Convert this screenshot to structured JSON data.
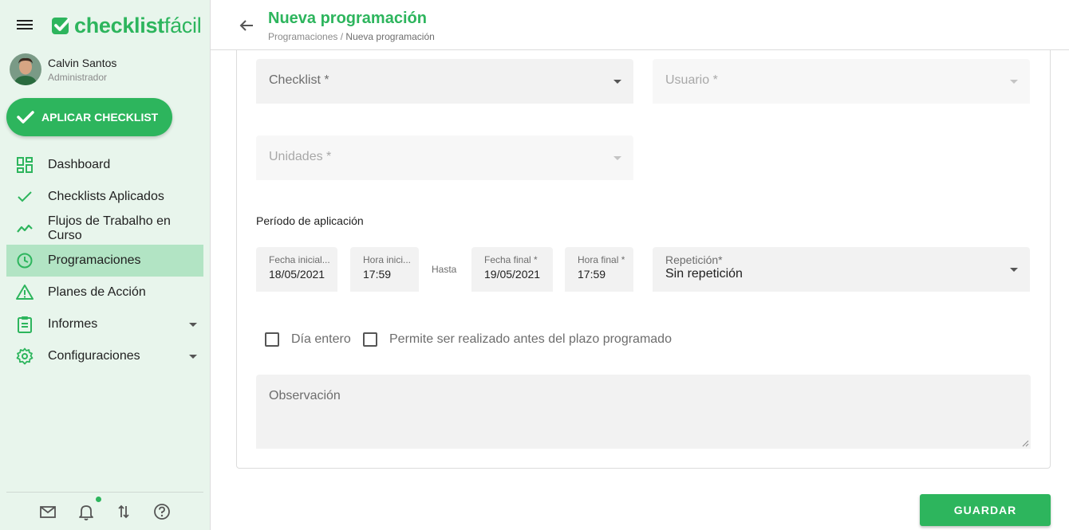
{
  "brand": {
    "name_bold": "checklist",
    "name_light": "fácil",
    "color": "#2db55d"
  },
  "user": {
    "name": "Calvin Santos",
    "role": "Administrador"
  },
  "apply_button": {
    "label": "APLICAR CHECKLIST"
  },
  "nav": {
    "items": [
      {
        "label": "Dashboard",
        "icon": "dashboard-icon"
      },
      {
        "label": "Checklists Aplicados",
        "icon": "check-icon"
      },
      {
        "label": "Flujos de Trabalho en Curso",
        "icon": "trending-icon"
      },
      {
        "label": "Programaciones",
        "icon": "clock-icon",
        "active": true
      },
      {
        "label": "Planes de Acción",
        "icon": "warning-icon"
      },
      {
        "label": "Informes",
        "icon": "clipboard-icon",
        "expandable": true
      },
      {
        "label": "Configuraciones",
        "icon": "gear-icon",
        "expandable": true
      }
    ]
  },
  "footer_icons": [
    "mail-icon",
    "bell-icon",
    "swap-icon",
    "help-icon"
  ],
  "header": {
    "title": "Nueva programación",
    "breadcrumb": {
      "parent": "Programaciones",
      "separator": "/",
      "current": "Nueva programación"
    }
  },
  "form": {
    "checklist": {
      "placeholder": "Checklist *"
    },
    "usuario": {
      "placeholder": "Usuario *"
    },
    "unidades": {
      "placeholder": "Unidades *"
    },
    "period_label": "Período de aplicación",
    "fecha_inicial": {
      "label": "Fecha inicial...",
      "value": "18/05/2021"
    },
    "hora_inicial": {
      "label": "Hora inici...",
      "value": "17:59"
    },
    "hasta": "Hasta",
    "fecha_final": {
      "label": "Fecha final *",
      "value": "19/05/2021"
    },
    "hora_final": {
      "label": "Hora final *",
      "value": "17:59"
    },
    "repeticion": {
      "label": "Repetición*",
      "value": "Sin repetición"
    },
    "dia_entero": {
      "label": "Día entero",
      "checked": false
    },
    "permite_antes": {
      "label": "Permite ser realizado antes del plazo programado",
      "checked": false
    },
    "observacion": {
      "placeholder": "Observación"
    }
  },
  "save_button": {
    "label": "GUARDAR"
  }
}
